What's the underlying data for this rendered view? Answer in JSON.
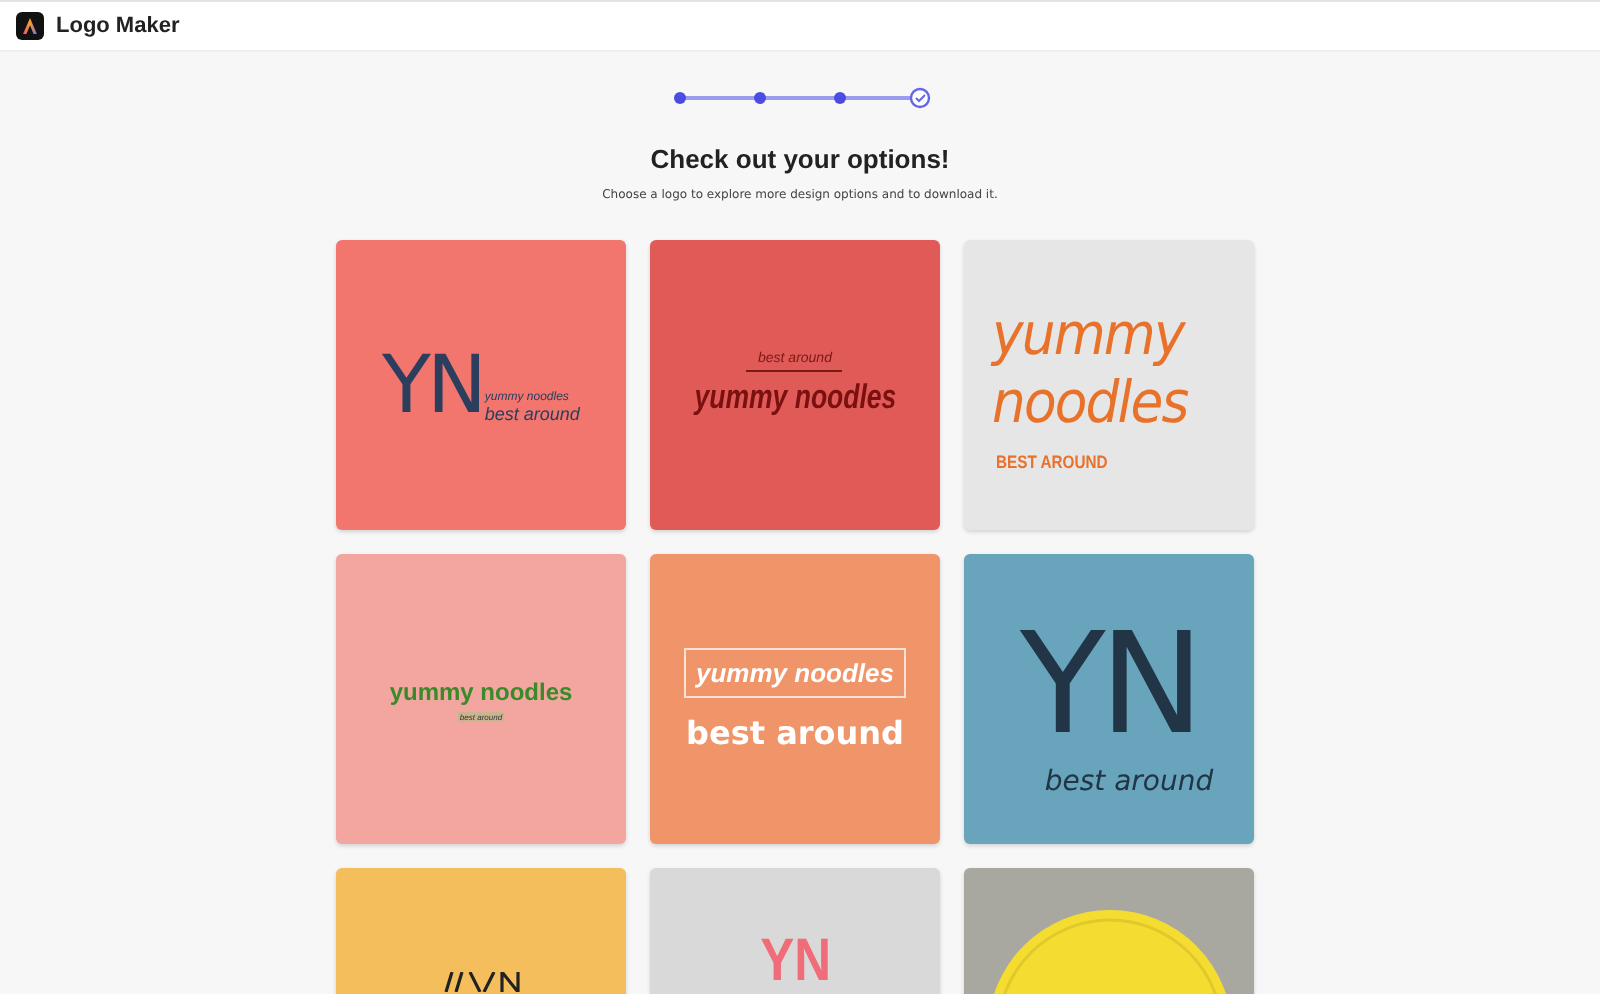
{
  "app": {
    "title": "Logo Maker"
  },
  "steps": [
    {
      "selected": false
    },
    {
      "selected": false
    },
    {
      "selected": false
    },
    {
      "selected": true
    }
  ],
  "heading": "Check out your options!",
  "subheading": "Choose a logo to explore more design options and to download it.",
  "cards": [
    {
      "kind": "monogram-side",
      "color": "#f2756e",
      "texts": [
        "YN",
        "yummy noodles",
        "best around"
      ]
    },
    {
      "kind": "ruled",
      "color": "#e05a58",
      "texts": [
        "best around",
        "yummy noodles"
      ]
    },
    {
      "kind": "stacked",
      "color": "#e6e6e6",
      "texts": [
        "yummy",
        "noodles",
        "BEST AROUND"
      ]
    },
    {
      "kind": "tagged",
      "color": "#f2a69f",
      "texts": [
        "yummy noodles",
        "best around"
      ]
    },
    {
      "kind": "boxed",
      "color": "#f0956a",
      "texts": [
        "yummy noodles",
        "best around"
      ]
    },
    {
      "kind": "monogram-big",
      "color": "#68a4bb",
      "texts": [
        "YN",
        "best around"
      ]
    },
    {
      "kind": "monogram-slash",
      "color": "#f5be5c"
    },
    {
      "kind": "monogram-tall",
      "color": "#d9d9d9",
      "texts": [
        "YN"
      ]
    },
    {
      "kind": "circle-badge",
      "color": "#a9a8a0"
    }
  ]
}
